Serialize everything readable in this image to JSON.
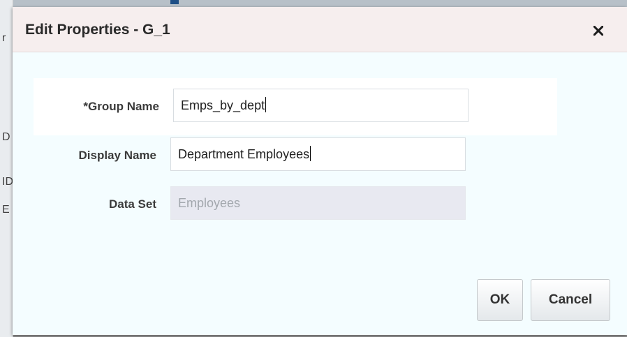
{
  "dialog": {
    "title": "Edit Properties - G_1",
    "close_icon": "close-icon"
  },
  "form": {
    "group_name": {
      "label": "*Group Name",
      "value": "Emps_by_dept"
    },
    "display_name": {
      "label": "Display Name",
      "value": "Department Employees"
    },
    "data_set": {
      "label": "Data Set",
      "value": "Employees"
    }
  },
  "buttons": {
    "ok_label": "OK",
    "cancel_label": "Cancel"
  },
  "background": {
    "edge_chars": [
      "r",
      "D",
      "ID",
      "E"
    ]
  },
  "colors": {
    "header_bg": "#f6eeee",
    "dialog_bg": "#f4fdff",
    "disabled_field_bg": "#e8e9f1"
  }
}
